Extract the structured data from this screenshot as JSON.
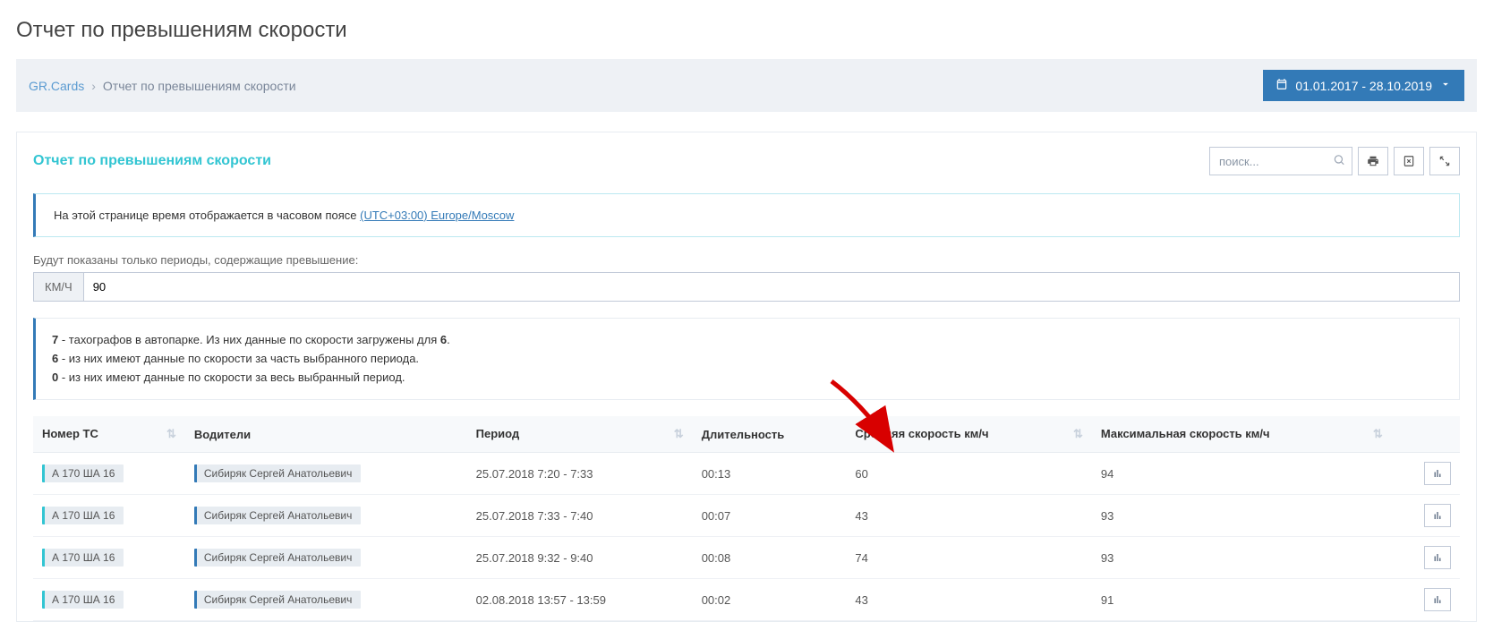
{
  "page_title": "Отчет по превышениям скорости",
  "breadcrumb": {
    "root": "GR.Cards",
    "sep": "›",
    "current": "Отчет по превышениям скорости"
  },
  "date_range": "01.01.2017 -  28.10.2019",
  "search": {
    "placeholder": "поиск..."
  },
  "card_title": "Отчет по превышениям скорости",
  "alert": {
    "prefix": "На этой странице время отображается в часовом поясе ",
    "link": "(UTC+03:00) Europe/Moscow"
  },
  "filter": {
    "label": "Будут показаны только периоды, содержащие превышение:",
    "prefix": "км/ч",
    "value": "90"
  },
  "well": {
    "n1": "7",
    "line1_mid": " - тахографов в автопарке. Из них данные по скорости загружены для ",
    "n1b": "6",
    "line1_end": ".",
    "n2": "6",
    "line2_end": " - из них имеют данные по скорости за часть выбранного периода.",
    "n3": "0",
    "line3_end": " - из них имеют данные по скорости за весь выбранный период."
  },
  "columns": {
    "vehicle": "Номер ТС",
    "drivers": "Водители",
    "period": "Период",
    "duration": "Длительность",
    "avg_speed": "Средняя скорость км/ч",
    "max_speed": "Максимальная скорость км/ч"
  },
  "rows": [
    {
      "vehicle": "А 170 ША 16",
      "driver": "Сибиряк Сергей Анатольевич",
      "period": "25.07.2018 7:20 - 7:33",
      "duration": "00:13",
      "avg": "60",
      "max": "94"
    },
    {
      "vehicle": "А 170 ША 16",
      "driver": "Сибиряк Сергей Анатольевич",
      "period": "25.07.2018 7:33 - 7:40",
      "duration": "00:07",
      "avg": "43",
      "max": "93"
    },
    {
      "vehicle": "А 170 ША 16",
      "driver": "Сибиряк Сергей Анатольевич",
      "period": "25.07.2018 9:32 - 9:40",
      "duration": "00:08",
      "avg": "74",
      "max": "93"
    },
    {
      "vehicle": "А 170 ША 16",
      "driver": "Сибиряк Сергей Анатольевич",
      "period": "02.08.2018 13:57 - 13:59",
      "duration": "00:02",
      "avg": "43",
      "max": "91"
    }
  ]
}
